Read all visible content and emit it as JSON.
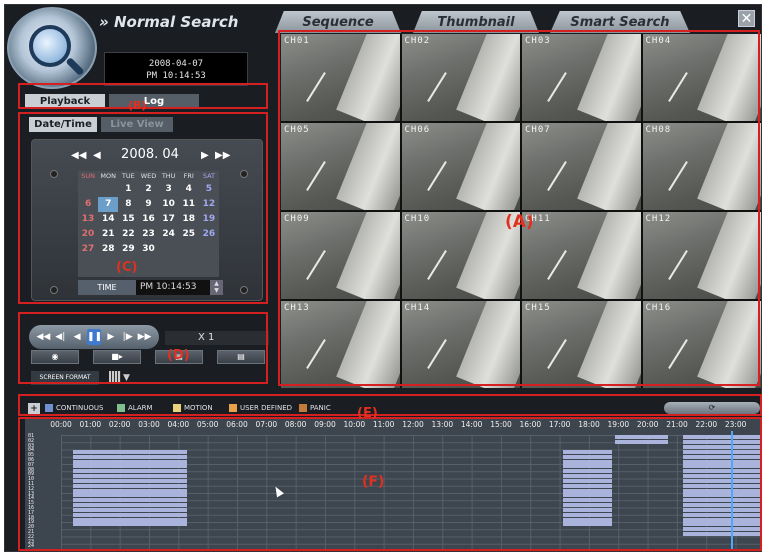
{
  "header": {
    "title": "Normal Search",
    "title_prefix": "»",
    "tabs": [
      "Sequence",
      "Thumbnail",
      "Smart Search"
    ],
    "close_label": "✕",
    "date": "2008-04-07",
    "time": "PM 10:14:53"
  },
  "channels": [
    "CH01",
    "CH02",
    "CH03",
    "CH04",
    "CH05",
    "CH06",
    "CH07",
    "CH08",
    "CH09",
    "CH10",
    "CH11",
    "CH12",
    "CH13",
    "CH14",
    "CH15",
    "CH16"
  ],
  "panel": {
    "playback_tab": "Playback",
    "log_tab": "Log",
    "datetime_tab": "Date/Time",
    "liveview_tab": "Live View"
  },
  "calendar": {
    "month": "2008. 04",
    "nav_first": "◀◀",
    "nav_prev": "◀",
    "nav_next": "▶",
    "nav_last": "▶▶",
    "weekdays": [
      "SUN",
      "MON",
      "TUE",
      "WED",
      "THU",
      "FRI",
      "SAT"
    ],
    "weeks": [
      [
        "",
        "",
        "1",
        "2",
        "3",
        "4",
        "5"
      ],
      [
        "6",
        "7",
        "8",
        "9",
        "10",
        "11",
        "12"
      ],
      [
        "13",
        "14",
        "15",
        "16",
        "17",
        "18",
        "19"
      ],
      [
        "20",
        "21",
        "22",
        "23",
        "24",
        "25",
        "26"
      ],
      [
        "27",
        "28",
        "29",
        "30",
        "",
        "",
        ""
      ]
    ],
    "selected": "7",
    "time_button": "TIME",
    "time_value": "PM 10:14:53"
  },
  "controls": {
    "speed": "X 1",
    "screen_format": "SCREEN FORMAT",
    "buttons": [
      "◉",
      "■▸",
      "▤",
      "▤"
    ]
  },
  "legend": {
    "items": [
      {
        "label": "CONTINUOUS",
        "color": "#6f8fd0"
      },
      {
        "label": "ALARM",
        "color": "#7fbf8f"
      },
      {
        "label": "MOTION",
        "color": "#e8d27a"
      },
      {
        "label": "USER DEFINED",
        "color": "#e8a04a"
      },
      {
        "label": "PANIC",
        "color": "#c47a3a"
      }
    ],
    "refresh_label": "⟳"
  },
  "timeline": {
    "hours": [
      "00:00",
      "01:00",
      "02:00",
      "03:00",
      "04:00",
      "05:00",
      "06:00",
      "07:00",
      "08:00",
      "09:00",
      "10:00",
      "11:00",
      "12:00",
      "13:00",
      "14:00",
      "15:00",
      "16:00",
      "17:00",
      "18:00",
      "19:00",
      "20:00",
      "21:00",
      "22:00",
      "23:00"
    ],
    "channels": [
      "01",
      "02",
      "03",
      "04",
      "05",
      "06",
      "07",
      "08",
      "09",
      "10",
      "11",
      "12",
      "13",
      "14",
      "15",
      "16",
      "17",
      "18",
      "19",
      "20",
      "21",
      "22",
      "23",
      "24"
    ]
  },
  "annotations": {
    "A": "(A)",
    "B": "(B)",
    "C": "(C)",
    "D": "(D)",
    "E": "(E)",
    "F": "(F)"
  }
}
